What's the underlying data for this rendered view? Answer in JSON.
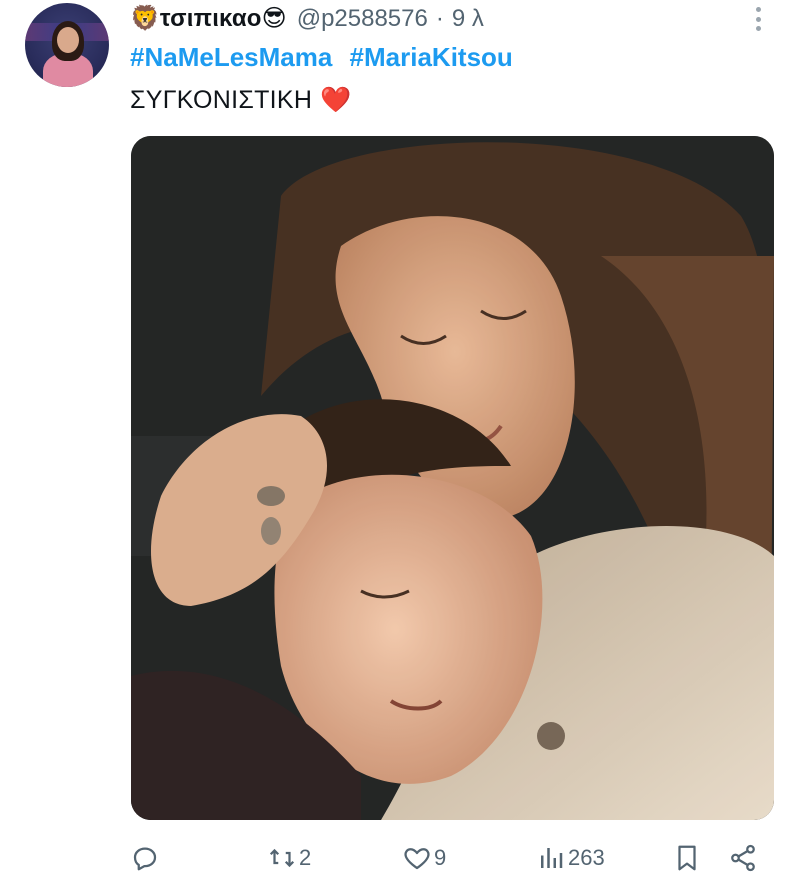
{
  "tweet": {
    "display_name": "τσιπικαο",
    "name_emoji_left": "🦁",
    "name_emoji_right": "😎",
    "handle": "@p2588576",
    "separator": "·",
    "time": "9 λ",
    "hashtags": [
      "#NaMeLesMama",
      "#MariaKitsou"
    ],
    "text": "ΣΥΓΚΟΝΙΣΤΙΚΗ",
    "text_emoji": "❤️"
  },
  "actions": {
    "reply_count": "",
    "retweet_count": "2",
    "like_count": "9",
    "views_count": "263"
  },
  "icons": {
    "more": "more-vertical-icon",
    "reply": "reply-icon",
    "retweet": "retweet-icon",
    "like": "heart-icon",
    "views": "views-icon",
    "bookmark": "bookmark-icon",
    "share": "share-icon"
  },
  "colors": {
    "link": "#1d9bf0",
    "secondary": "#536471",
    "text": "#0f1419"
  }
}
